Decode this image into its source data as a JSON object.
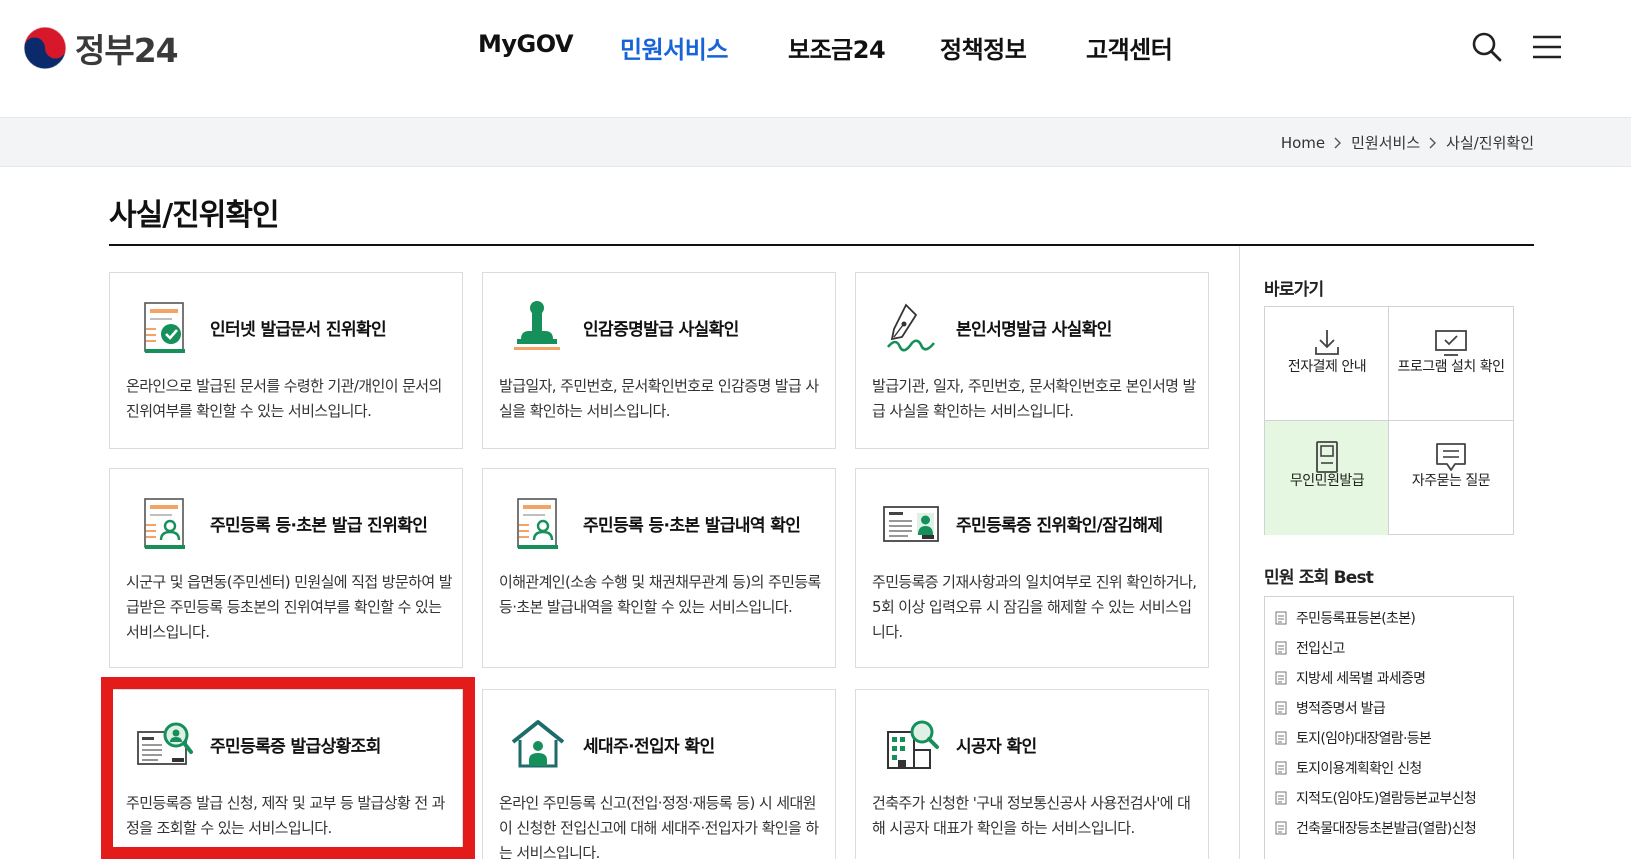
{
  "header": {
    "logo_text": "정부24",
    "nav": [
      {
        "label": "MyGOV"
      },
      {
        "label": "민원서비스"
      },
      {
        "label": "보조금24"
      },
      {
        "label": "정책정보"
      },
      {
        "label": "고객센터"
      }
    ],
    "active_nav": "민원서비스",
    "icons": [
      "search-icon",
      "menu-icon"
    ]
  },
  "breadcrumb": [
    "Home",
    "민원서비스",
    "사실/진위확인"
  ],
  "page": {
    "title": "사실/진위확인"
  },
  "cards": [
    {
      "title": "인터넷 발급문서 진위확인",
      "desc": "온라인으로 발급된 문서를 수령한 기관/개인이 문서의 진위여부를 확인할 수 있는 서비스입니다.",
      "icon": "document-check-icon"
    },
    {
      "title": "인감증명발급 사실확인",
      "desc": "발급일자, 주민번호, 문서확인번호로 인감증명 발급 사실을 확인하는 서비스입니다.",
      "icon": "seal-stamp-icon"
    },
    {
      "title": "본인서명발급 사실확인",
      "desc": "발급기관, 일자, 주민번호, 문서확인번호로 본인서명 발급 사실을 확인하는 서비스입니다.",
      "icon": "pen-signature-icon"
    },
    {
      "title": "주민등록 등·초본 발급 진위확인",
      "desc": "시군구 및 읍면동(주민센터) 민원실에 직접 방문하여 발급받은 주민등록 등초본의 진위여부를 확인할 수 있는 서비스입니다.",
      "icon": "resident-document-icon"
    },
    {
      "title": "주민등록 등·초본 발급내역 확인",
      "desc": "이해관계인(소송 수행 및 채권채무관계 등)의 주민등록 등·초본 발급내역을 확인할 수 있는 서비스입니다.",
      "icon": "resident-document-icon"
    },
    {
      "title": "주민등록증 진위확인/잠김해제",
      "desc": "주민등록증 기재사항과의 일치여부로 진위 확인하거나, 5회 이상 입력오류 시 잠김을 해제할 수 있는 서비스입니다.",
      "icon": "id-card-icon"
    },
    {
      "title": "주민등록증 발급상황조회",
      "desc": "주민등록증 발급 신청, 제작 및 교부 등 발급상황 전 과정을 조회할 수 있는 서비스입니다.",
      "icon": "id-card-search-icon"
    },
    {
      "title": "세대주·전입자 확인",
      "desc": "온라인 주민등록 신고(전입·정정·재등록 등) 시 세대원이 신청한 전입신고에 대해 세대주·전입자가 확인을 하는 서비스입니다.",
      "icon": "house-person-icon"
    },
    {
      "title": "시공자 확인",
      "desc": "건축주가 신청한 '구내 정보통신공사 사용전검사'에 대해 시공자 대표가 확인을 하는 서비스입니다.",
      "icon": "building-search-icon"
    }
  ],
  "sidebar": {
    "quick_title": "바로가기",
    "quick_links": [
      {
        "label": "전자결제 안내",
        "icon": "download-icon"
      },
      {
        "label": "프로그램 설치 확인",
        "icon": "monitor-check-icon"
      },
      {
        "label": "무인민원발급",
        "icon": "kiosk-icon"
      },
      {
        "label": "자주묻는 질문",
        "icon": "chat-bubble-icon"
      }
    ],
    "best_title": "민원 조회 Best",
    "best_items": [
      "주민등록표등본(초본)",
      "전입신고",
      "지방세 세목별 과세증명",
      "병적증명서 발급",
      "토지(임야)대장열람·등본",
      "토지이용계획확인 신청",
      "지적도(임야도)열람등본교부신청",
      "건축물대장등초본발급(열람)신청"
    ]
  },
  "colors": {
    "brand_blue": "#1664d8",
    "accent_green": "#16905a",
    "highlight_red": "#e31b1b",
    "selected_bg": "#e5f7e1"
  }
}
